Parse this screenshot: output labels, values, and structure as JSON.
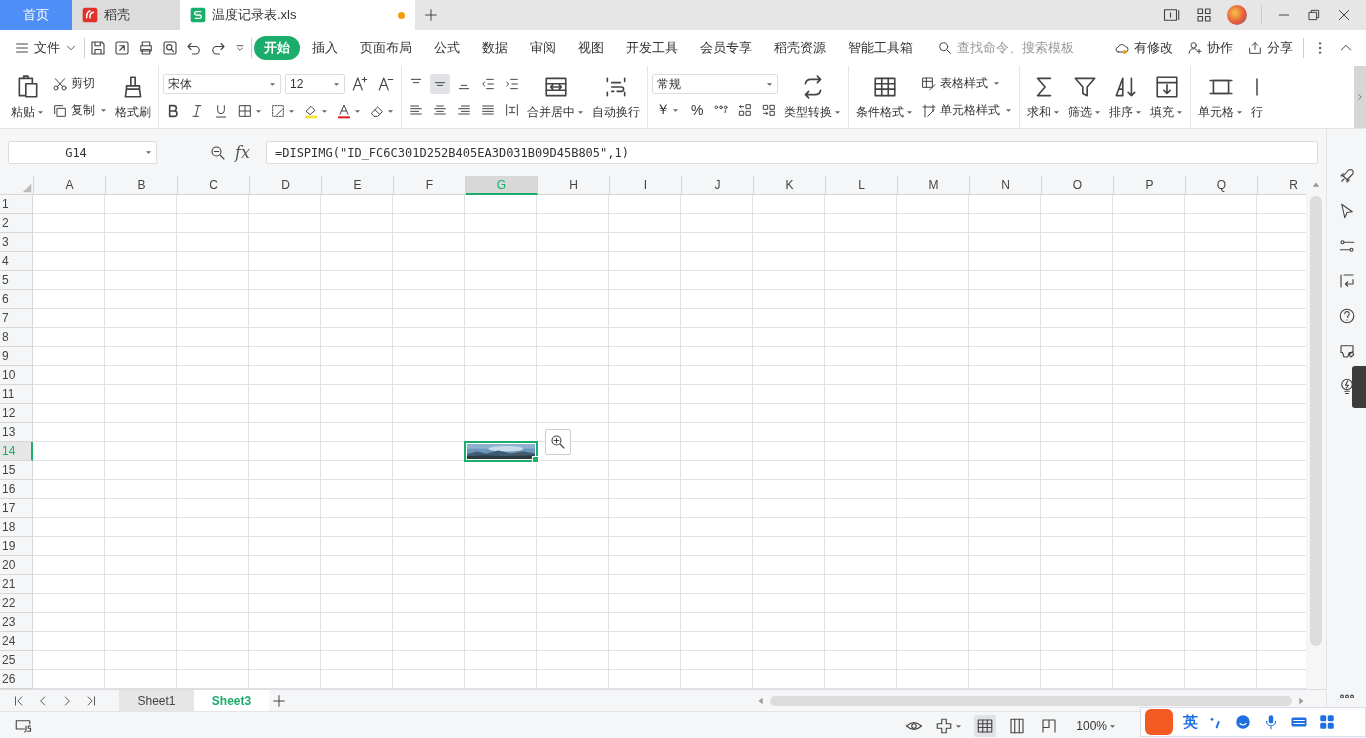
{
  "tabs": [
    {
      "label": "首页",
      "kind": "home",
      "selected": false
    },
    {
      "label": "稻壳",
      "kind": "docer",
      "selected": false
    },
    {
      "label": "温度记录表.xls",
      "kind": "sheet",
      "selected": true,
      "unsaved": true
    }
  ],
  "menu": {
    "file": "文件",
    "tabs": [
      {
        "label": "开始",
        "selected": true
      },
      {
        "label": "插入",
        "selected": false
      },
      {
        "label": "页面布局",
        "selected": false
      },
      {
        "label": "公式",
        "selected": false
      },
      {
        "label": "数据",
        "selected": false
      },
      {
        "label": "审阅",
        "selected": false
      },
      {
        "label": "视图",
        "selected": false
      },
      {
        "label": "开发工具",
        "selected": false
      },
      {
        "label": "会员专享",
        "selected": false
      },
      {
        "label": "稻壳资源",
        "selected": false
      },
      {
        "label": "智能工具箱",
        "selected": false
      }
    ],
    "search": {
      "placeholder": "查找命令、搜索模板"
    },
    "actions": [
      "有修改",
      "协作",
      "分享"
    ]
  },
  "ribbon": {
    "paste": "粘贴",
    "cut": "剪切",
    "copy": "复制",
    "format_painter": "格式刷",
    "font": "宋体",
    "font_size": "12",
    "vertical_align": [
      {
        "selected": false
      },
      {
        "selected": true
      },
      {
        "selected": false
      }
    ],
    "merge": "合并居中",
    "wrap": "自动换行",
    "number_format": "常规",
    "currency": "￥",
    "percent": "%",
    "convert": "类型转换",
    "conditional": "条件格式",
    "table_style": "表格样式",
    "cell_style": "单元格样式",
    "sum": "求和",
    "filter": "筛选",
    "sort": "排序",
    "fill": "填充",
    "cells": "单元格",
    "rows": "行"
  },
  "formula_bar": {
    "name_box": "G14",
    "fx": "fx",
    "formula": "=DISPIMG(\"ID_FC6C301D252B405EA3D031B09D45B805\",1)"
  },
  "grid": {
    "columns": [
      {
        "label": "A",
        "selected": false
      },
      {
        "label": "B",
        "selected": false
      },
      {
        "label": "C",
        "selected": false
      },
      {
        "label": "D",
        "selected": false
      },
      {
        "label": "E",
        "selected": false
      },
      {
        "label": "F",
        "selected": false
      },
      {
        "label": "G",
        "selected": true
      },
      {
        "label": "H",
        "selected": false
      },
      {
        "label": "I",
        "selected": false
      },
      {
        "label": "J",
        "selected": false
      },
      {
        "label": "K",
        "selected": false
      },
      {
        "label": "L",
        "selected": false
      },
      {
        "label": "M",
        "selected": false
      },
      {
        "label": "N",
        "selected": false
      },
      {
        "label": "O",
        "selected": false
      },
      {
        "label": "P",
        "selected": false
      },
      {
        "label": "Q",
        "selected": false
      },
      {
        "label": "R",
        "selected": false
      }
    ],
    "rows": [
      {
        "label": "1",
        "selected": false
      },
      {
        "label": "2",
        "selected": false
      },
      {
        "label": "3",
        "selected": false
      },
      {
        "label": "4",
        "selected": false
      },
      {
        "label": "5",
        "selected": false
      },
      {
        "label": "6",
        "selected": false
      },
      {
        "label": "7",
        "selected": false
      },
      {
        "label": "8",
        "selected": false
      },
      {
        "label": "9",
        "selected": false
      },
      {
        "label": "10",
        "selected": false
      },
      {
        "label": "11",
        "selected": false
      },
      {
        "label": "12",
        "selected": false
      },
      {
        "label": "13",
        "selected": false
      },
      {
        "label": "14",
        "selected": true
      },
      {
        "label": "15",
        "selected": false
      },
      {
        "label": "16",
        "selected": false
      },
      {
        "label": "17",
        "selected": false
      },
      {
        "label": "18",
        "selected": false
      },
      {
        "label": "19",
        "selected": false
      },
      {
        "label": "20",
        "selected": false
      },
      {
        "label": "21",
        "selected": false
      },
      {
        "label": "22",
        "selected": false
      },
      {
        "label": "23",
        "selected": false
      },
      {
        "label": "24",
        "selected": false
      },
      {
        "label": "25",
        "selected": false
      },
      {
        "label": "26",
        "selected": false
      }
    ]
  },
  "sheets": [
    {
      "label": "Sheet1",
      "selected": false
    },
    {
      "label": "Sheet3",
      "selected": true
    }
  ],
  "status": {
    "zoom": "100%",
    "views": [
      {
        "selected": true
      },
      {
        "selected": false
      },
      {
        "selected": false
      }
    ]
  },
  "ime": {
    "mode": "英"
  }
}
